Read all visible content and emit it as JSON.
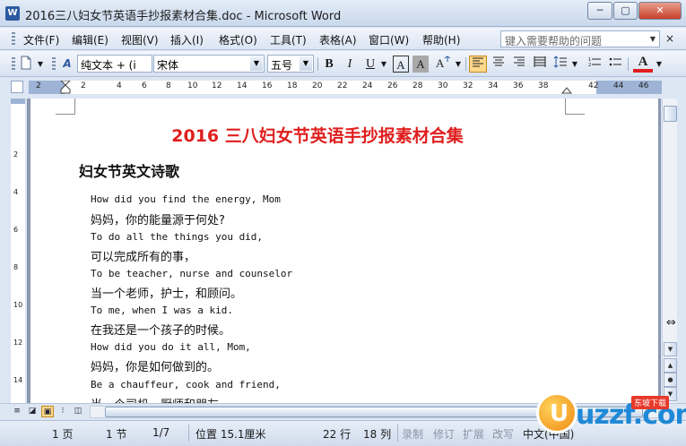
{
  "window": {
    "title": "2016三八妇女节英语手抄报素材合集.doc - Microsoft Word",
    "app_icon": "W",
    "controls": {
      "minimize": "─",
      "maximize": "▢",
      "close": "✕"
    }
  },
  "menu": {
    "items": [
      "文件(F)",
      "编辑(E)",
      "视图(V)",
      "插入(I)",
      "格式(O)",
      "工具(T)",
      "表格(A)",
      "窗口(W)",
      "帮助(H)"
    ],
    "help_placeholder": "键入需要帮助的问题",
    "doc_close": "×"
  },
  "toolbar": {
    "style_value": "纯文本 + (i",
    "font_value": "宋体",
    "size_value": "五号",
    "bold": "B",
    "italic": "I",
    "underline": "U",
    "char_border": "A",
    "char_shading": "A",
    "font_color": "A",
    "icons": [
      "new-page-icon",
      "styles-pane-icon",
      "align-left-icon",
      "align-center-icon",
      "align-right-icon",
      "justify-icon",
      "line-spacing-icon",
      "numbering-icon",
      "bullets-icon",
      "font-color-icon"
    ],
    "accent_color": "#ffd88a",
    "font_color_swatch": "#e01e1e"
  },
  "ruler": {
    "marks": [
      "2",
      "2",
      "4",
      "6",
      "8",
      "10",
      "12",
      "14",
      "16",
      "18",
      "20",
      "22",
      "24",
      "26",
      "28",
      "30",
      "32",
      "34",
      "36",
      "38",
      "42",
      "44",
      "46"
    ],
    "vertical_marks": [
      "2",
      "4",
      "6",
      "8",
      "10",
      "12",
      "14"
    ]
  },
  "document": {
    "title": "2016 三八妇女节英语手抄报素材合集",
    "title_color": "#e01e1e",
    "subtitle": "妇女节英文诗歌",
    "lines": [
      {
        "lang": "en",
        "text": "How did you find the energy, Mom"
      },
      {
        "lang": "zh",
        "text": "妈妈，你的能量源于何处?"
      },
      {
        "lang": "en",
        "text": "To do all the things you did,"
      },
      {
        "lang": "zh",
        "text": "可以完成所有的事，"
      },
      {
        "lang": "en",
        "text": "To be teacher, nurse and counselor"
      },
      {
        "lang": "zh",
        "text": "当一个老师，护士，和顾问。"
      },
      {
        "lang": "en",
        "text": "To me, when I was a kid."
      },
      {
        "lang": "zh",
        "text": "在我还是一个孩子的时候。"
      },
      {
        "lang": "en",
        "text": "How did you do it all, Mom,"
      },
      {
        "lang": "zh",
        "text": "妈妈，你是如何做到的。"
      },
      {
        "lang": "en",
        "text": "Be a chauffeur, cook and friend,"
      },
      {
        "lang": "zh",
        "text": "当一个司机，厨师和朋友"
      }
    ]
  },
  "statusbar": {
    "page": "1 页",
    "section": "1 节",
    "page_of": "1/7",
    "position": "位置 15.1厘米",
    "line": "22 行",
    "column": "18 列",
    "rec": "录制",
    "trk": "修订",
    "ext": "扩展",
    "ovr": "改写",
    "language": "中文(中国)"
  },
  "watermark": {
    "mark": "U",
    "brand": "uzzf.com",
    "tag": "东坡下载"
  }
}
